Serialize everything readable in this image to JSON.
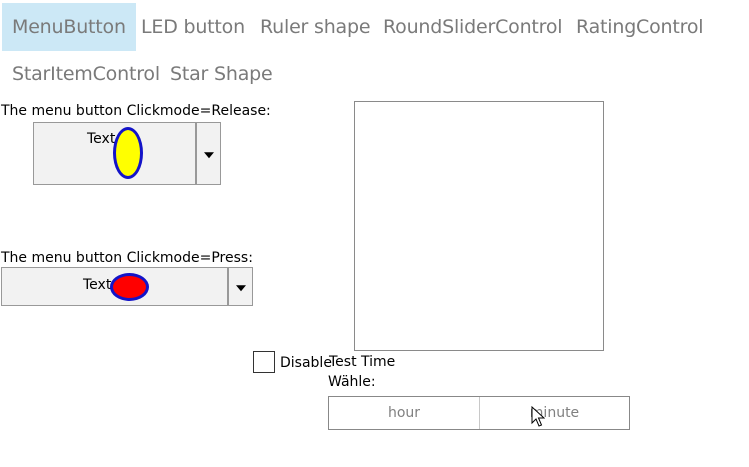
{
  "tabs": [
    {
      "label": "MenuButton",
      "selected": true
    },
    {
      "label": "LED button",
      "selected": false
    },
    {
      "label": "Ruler shape",
      "selected": false
    },
    {
      "label": "RoundSliderControl",
      "selected": false
    },
    {
      "label": "RatingControl",
      "selected": false
    },
    {
      "label": "StarItemControl",
      "selected": false
    },
    {
      "label": "Star Shape",
      "selected": false
    }
  ],
  "release_section": {
    "label": "The menu button Clickmode=Release:",
    "button_text": "Text",
    "ellipse_fill": "#ffff00",
    "ellipse_stroke": "#1414c8",
    "dropdown_icon": "chevron-down-icon"
  },
  "press_section": {
    "label": "The menu button Clickmode=Press:",
    "button_text": "Text",
    "ellipse_fill": "#ff0000",
    "ellipse_stroke": "#1414c8",
    "dropdown_icon": "chevron-down-icon"
  },
  "disable_checkbox": {
    "label": "Disable",
    "checked": false
  },
  "test_time": {
    "title": "Test Time",
    "subtitle": "Wähle:",
    "hour_placeholder": "hour",
    "minute_placeholder": "minute"
  },
  "colors": {
    "selected_tab_bg": "#cce8f6",
    "tab_text": "#7a7a7a"
  }
}
